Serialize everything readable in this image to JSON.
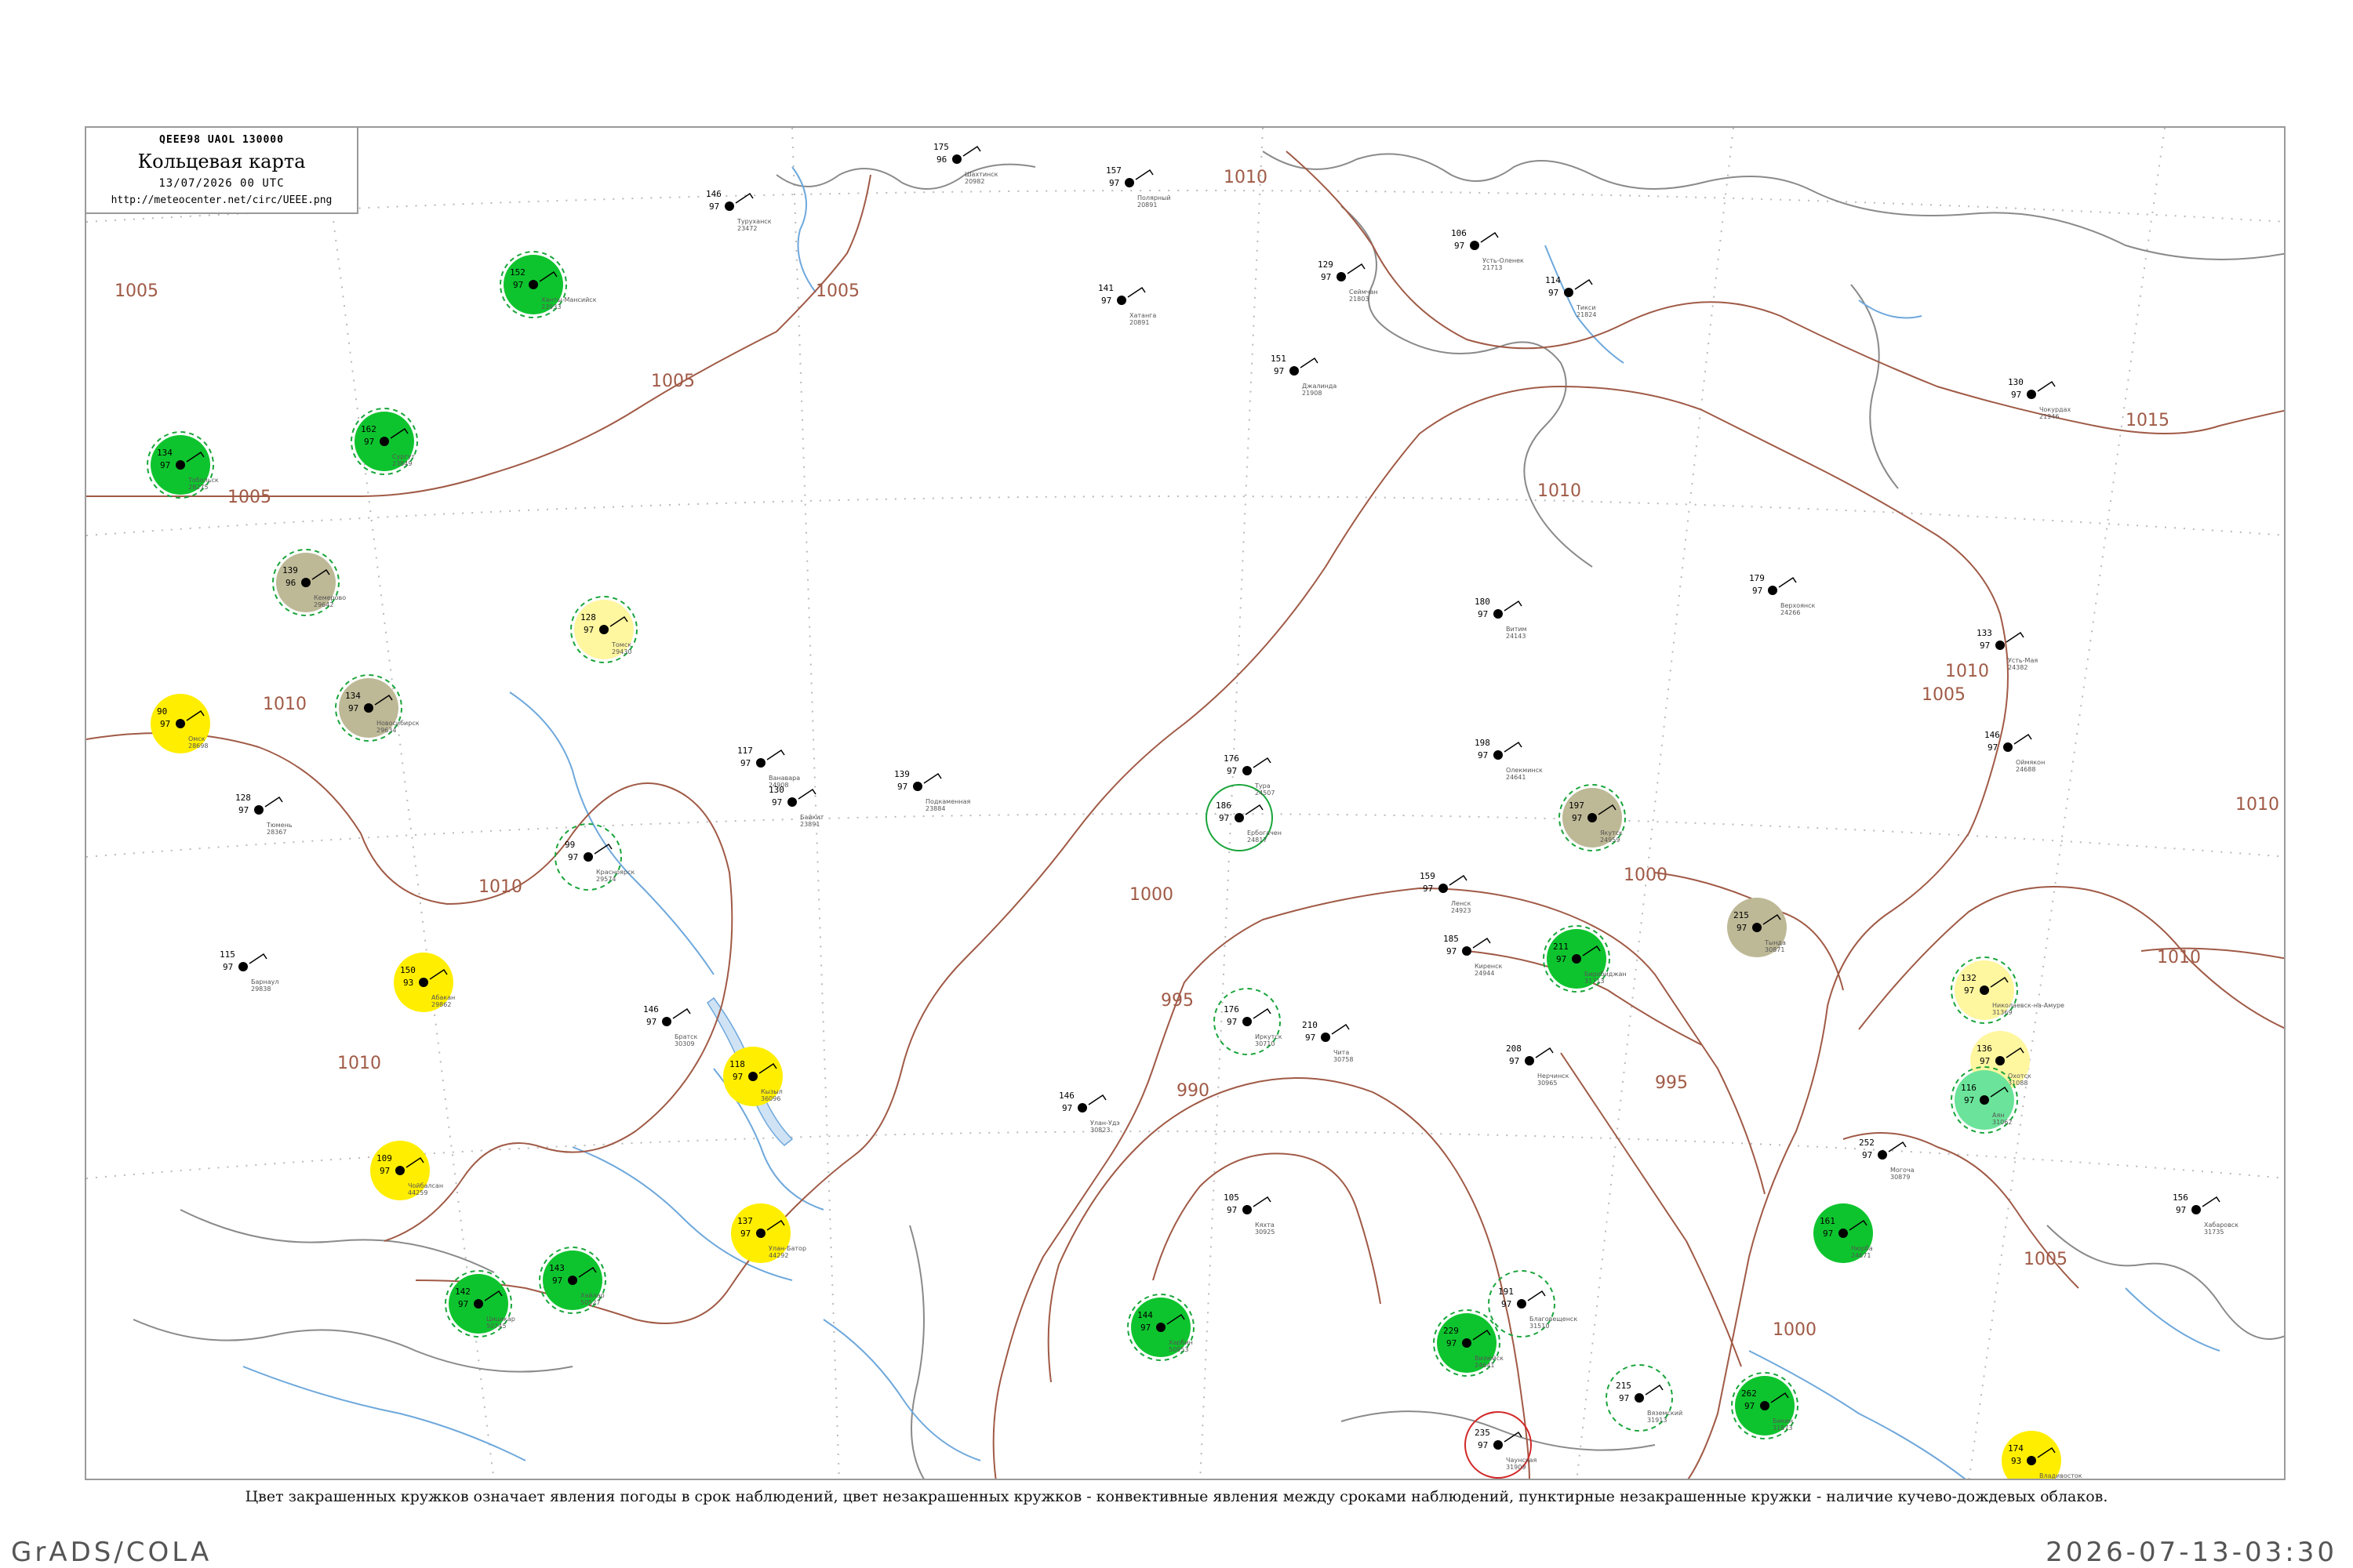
{
  "header": {
    "code": "QEEE98  UAOL  130000",
    "title": "Кольцевая карта",
    "date": "13/07/2026 00 UTC",
    "url": "http://meteocenter.net/circ/UEEE.png"
  },
  "caption": "Цвет закрашенных кружков означает явления погоды в срок наблюдений, цвет незакрашенных кружков - конвективные явления между сроками наблюдений, пунктирные незакрашенные кружки - наличие кучево-дождевых облаков.",
  "footer": {
    "left": "GrADS/COLA",
    "right": "2026-07-13-03:30"
  },
  "colors": {
    "isobar": "#a05a46",
    "river": "#6ea8dc",
    "dotted_grid": "#b9b9b9",
    "shower_green": "#0ec42e",
    "light_green": "#6be39a",
    "yellow": "#ffee00",
    "pale_yellow": "#fff6a0",
    "khaki": "#bdb896",
    "ring_green": "#1aa53b",
    "ring_red": "#d22828"
  },
  "isobars": [
    "1005",
    "1005",
    "1005",
    "1010",
    "1010",
    "1010",
    "1010",
    "1015",
    "1010",
    "1010",
    "1005",
    "1005",
    "1000",
    "995",
    "990",
    "1000",
    "1010",
    "1005",
    "995",
    "1000",
    "1010",
    "1010"
  ],
  "stations": [
    {
      "name": "Шахтинск",
      "num": "20982",
      "p": "175",
      "d": "96",
      "fill": "none",
      "ring": "none"
    },
    {
      "name": "Полярный",
      "num": "20891",
      "p": "157",
      "d": "97",
      "fill": "none",
      "ring": "none"
    },
    {
      "name": "Сеймчан",
      "num": "21803",
      "p": "129",
      "d": "97",
      "fill": "none",
      "ring": "none"
    },
    {
      "name": "Хатанга",
      "num": "20891",
      "p": "141",
      "d": "97",
      "fill": "none",
      "ring": "none"
    },
    {
      "name": "Усть-Оленек",
      "num": "21713",
      "p": "106",
      "d": "97",
      "fill": "none",
      "ring": "none"
    },
    {
      "name": "Тикси",
      "num": "21824",
      "p": "114",
      "d": "97",
      "fill": "none",
      "ring": "none"
    },
    {
      "name": "Джалинда",
      "num": "21908",
      "p": "151",
      "d": "97",
      "fill": "none",
      "ring": "none"
    },
    {
      "name": "Чокурдах",
      "num": "21946",
      "p": "130",
      "d": "97",
      "fill": "none",
      "ring": "none"
    },
    {
      "name": "Верхоянск",
      "num": "24266",
      "p": "179",
      "d": "97",
      "fill": "none",
      "ring": "none"
    },
    {
      "name": "Усть-Мая",
      "num": "24382",
      "p": "133",
      "d": "97",
      "fill": "none",
      "ring": "none"
    },
    {
      "name": "Оймякон",
      "num": "24688",
      "p": "146",
      "d": "97",
      "fill": "none",
      "ring": "none"
    },
    {
      "name": "Витим",
      "num": "24143",
      "p": "180",
      "d": "97",
      "fill": "none",
      "ring": "none"
    },
    {
      "name": "Олекминск",
      "num": "24641",
      "p": "198",
      "d": "97",
      "fill": "none",
      "ring": "none"
    },
    {
      "name": "Якутск",
      "num": "24959",
      "p": "197",
      "d": "97",
      "fill": "khaki",
      "ring": "dashed-green"
    },
    {
      "name": "Ленск",
      "num": "24923",
      "p": "159",
      "d": "97",
      "fill": "none",
      "ring": "none"
    },
    {
      "name": "Киренск",
      "num": "24944",
      "p": "185",
      "d": "97",
      "fill": "none",
      "ring": "none"
    },
    {
      "name": "Туруханск",
      "num": "23472",
      "p": "146",
      "d": "97",
      "fill": "none",
      "ring": "none"
    },
    {
      "name": "Ванавара",
      "num": "24908",
      "p": "117",
      "d": "97",
      "fill": "none",
      "ring": "none"
    },
    {
      "name": "Подкаменная",
      "num": "23884",
      "p": "139",
      "d": "97",
      "fill": "none",
      "ring": "none"
    },
    {
      "name": "Байкит",
      "num": "23891",
      "p": "130",
      "d": "97",
      "fill": "none",
      "ring": "none"
    },
    {
      "name": "Ербогачен",
      "num": "24817",
      "p": "186",
      "d": "97",
      "fill": "none",
      "ring": "solid-green"
    },
    {
      "name": "Тура",
      "num": "24507",
      "p": "176",
      "d": "97",
      "fill": "none",
      "ring": "none"
    },
    {
      "name": "Братск",
      "num": "30309",
      "p": "146",
      "d": "97",
      "fill": "none",
      "ring": "none"
    },
    {
      "name": "Иркутск",
      "num": "30710",
      "p": "176",
      "d": "97",
      "fill": "none",
      "ring": "dashed-green"
    },
    {
      "name": "Чита",
      "num": "30758",
      "p": "210",
      "d": "97",
      "fill": "none",
      "ring": "none"
    },
    {
      "name": "Нерчинск",
      "num": "30965",
      "p": "208",
      "d": "97",
      "fill": "none",
      "ring": "none"
    },
    {
      "name": "Могоча",
      "num": "30879",
      "p": "252",
      "d": "97",
      "fill": "none",
      "ring": "none"
    },
    {
      "name": "Тында",
      "num": "30871",
      "p": "215",
      "d": "97",
      "fill": "khaki",
      "ring": "none"
    },
    {
      "name": "Благовещенск",
      "num": "31510",
      "p": "191",
      "d": "97",
      "fill": "none",
      "ring": "dashed-green"
    },
    {
      "name": "Хабаровск",
      "num": "31735",
      "p": "156",
      "d": "97",
      "fill": "none",
      "ring": "none"
    },
    {
      "name": "Николаевск-на-Амуре",
      "num": "31369",
      "p": "132",
      "d": "97",
      "fill": "pale-yellow",
      "ring": "dashed-green"
    },
    {
      "name": "Охотск",
      "num": "31088",
      "p": "136",
      "d": "97",
      "fill": "pale-yellow",
      "ring": "none"
    },
    {
      "name": "Аян",
      "num": "31062",
      "p": "116",
      "d": "97",
      "fill": "light-green",
      "ring": "dashed-green"
    },
    {
      "name": "Томск",
      "num": "29430",
      "p": "128",
      "d": "97",
      "fill": "pale-yellow",
      "ring": "dashed-green"
    },
    {
      "name": "Новосибирск",
      "num": "29634",
      "p": "134",
      "d": "97",
      "fill": "khaki",
      "ring": "dashed-green"
    },
    {
      "name": "Барнаул",
      "num": "29838",
      "p": "115",
      "d": "97",
      "fill": "none",
      "ring": "none"
    },
    {
      "name": "Кемерово",
      "num": "29642",
      "p": "139",
      "d": "96",
      "fill": "khaki",
      "ring": "dashed-green"
    },
    {
      "name": "Омск",
      "num": "28698",
      "p": "90",
      "d": "97",
      "fill": "yellow",
      "ring": "none"
    },
    {
      "name": "Тюмень",
      "num": "28367",
      "p": "128",
      "d": "97",
      "fill": "none",
      "ring": "none"
    },
    {
      "name": "Ханты-Мансийск",
      "num": "23933",
      "p": "152",
      "d": "97",
      "fill": "shower-green",
      "ring": "dashed-green"
    },
    {
      "name": "Сургут",
      "num": "23849",
      "p": "162",
      "d": "97",
      "fill": "shower-green",
      "ring": "dashed-green"
    },
    {
      "name": "Тобольск",
      "num": "28275",
      "p": "134",
      "d": "97",
      "fill": "shower-green",
      "ring": "dashed-green"
    },
    {
      "name": "Красноярск",
      "num": "29574",
      "p": "99",
      "d": "97",
      "fill": "none",
      "ring": "dashed-green"
    },
    {
      "name": "Абакан",
      "num": "29862",
      "p": "150",
      "d": "93",
      "fill": "yellow",
      "ring": "none"
    },
    {
      "name": "Кызыл",
      "num": "36096",
      "p": "118",
      "d": "97",
      "fill": "yellow",
      "ring": "none"
    },
    {
      "name": "Улан-Удэ",
      "num": "30823",
      "p": "146",
      "d": "97",
      "fill": "none",
      "ring": "none"
    },
    {
      "name": "Кяхта",
      "num": "30925",
      "p": "105",
      "d": "97",
      "fill": "none",
      "ring": "none"
    },
    {
      "name": "Чойбалсан",
      "num": "44259",
      "p": "109",
      "d": "97",
      "fill": "yellow",
      "ring": "none"
    },
    {
      "name": "Улан-Батор",
      "num": "44292",
      "p": "137",
      "d": "97",
      "fill": "yellow",
      "ring": "none"
    },
    {
      "name": "Хайлар",
      "num": "50527",
      "p": "143",
      "d": "97",
      "fill": "shower-green",
      "ring": "dashed-green"
    },
    {
      "name": "Цицикар",
      "num": "50745",
      "p": "142",
      "d": "97",
      "fill": "shower-green",
      "ring": "dashed-green"
    },
    {
      "name": "Харбин",
      "num": "50953",
      "p": "144",
      "d": "97",
      "fill": "shower-green",
      "ring": "dashed-green"
    },
    {
      "name": "Владивосток",
      "num": "31960",
      "p": "174",
      "d": "93",
      "fill": "yellow",
      "ring": "none"
    },
    {
      "name": "Чаунская",
      "num": "31909",
      "p": "235",
      "d": "97",
      "fill": "none",
      "ring": "solid-red"
    },
    {
      "name": "Вяземский",
      "num": "31913",
      "p": "215",
      "d": "97",
      "fill": "none",
      "ring": "dashed-green"
    },
    {
      "name": "Бикин",
      "num": "31873",
      "p": "262",
      "d": "97",
      "fill": "shower-green",
      "ring": "dashed-green"
    },
    {
      "name": "Биробиджан",
      "num": "31713",
      "p": "211",
      "d": "97",
      "fill": "shower-green",
      "ring": "dashed-green"
    },
    {
      "name": "Нюрба",
      "num": "24671",
      "p": "161",
      "d": "97",
      "fill": "shower-green",
      "ring": "none"
    },
    {
      "name": "Вилюйск",
      "num": "24641",
      "p": "229",
      "d": "97",
      "fill": "shower-green",
      "ring": "dashed-green"
    }
  ]
}
